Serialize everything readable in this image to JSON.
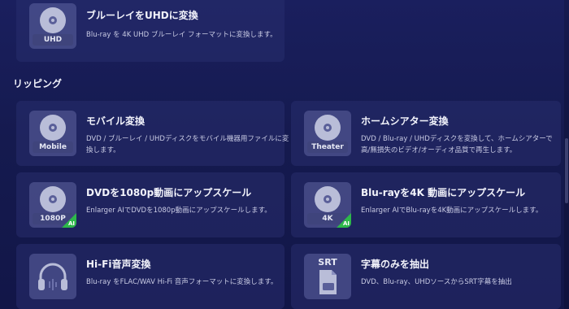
{
  "top_card": {
    "title": "ブルーレイをUHDに変換",
    "desc": "Blu-ray を 4K UHD ブルーレイ フォーマットに変換します。",
    "icon_label": "UHD"
  },
  "section": {
    "title": "リッピング"
  },
  "cards": [
    {
      "title": "モバイル変換",
      "desc": "DVD / ブルーレイ / UHDディスクをモバイル機器用ファイルに変換します。",
      "icon_label": "Mobile",
      "icon": "disc-icon",
      "ai": false
    },
    {
      "title": "ホームシアター変換",
      "desc": "DVD / Blu-ray / UHDディスクを変換して、ホームシアターで高/無損失のビデオ/オーディオ品質で再生します。",
      "icon_label": "Theater",
      "icon": "disc-icon",
      "ai": false
    },
    {
      "title": "DVDを1080p動画にアップスケール",
      "desc": "Enlarger AIでDVDを1080p動画にアップスケールします。",
      "icon_label": "1080P",
      "icon": "disc-icon",
      "ai": true,
      "ai_label": "AI"
    },
    {
      "title": "Blu-rayを4K 動画にアップスケール",
      "desc": "Enlarger AIでBlu-rayを4K動画にアップスケールします。",
      "icon_label": "4K",
      "icon": "disc-icon",
      "ai": true,
      "ai_label": "AI"
    },
    {
      "title": "Hi-Fi音声変換",
      "desc": "Blu-ray をFLAC/WAV Hi-Fi 音声フォーマットに変換します。",
      "icon": "headphones-icon",
      "ai": false
    },
    {
      "title": "字幕のみを抽出",
      "desc": "DVD、Blu-ray、UHDソースからSRT字幕を抽出",
      "icon_label": "SRT",
      "icon": "srt-file-icon",
      "ai": false
    }
  ]
}
